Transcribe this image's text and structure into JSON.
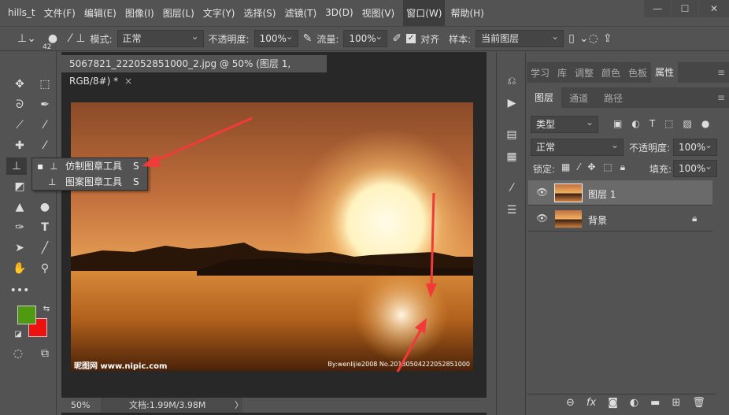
{
  "app": {
    "title": "hills_t"
  },
  "menu": [
    "文件(F)",
    "编辑(E)",
    "图像(I)",
    "图层(L)",
    "文字(Y)",
    "选择(S)",
    "滤镜(T)",
    "3D(D)",
    "视图(V)",
    "窗口(W)",
    "帮助(H)"
  ],
  "window_controls": {
    "minimize": "—",
    "maximize": "☐",
    "close": "✕"
  },
  "options": {
    "brush_size": "42",
    "mode_label": "模式:",
    "mode_value": "正常",
    "opacity_label": "不透明度:",
    "opacity_value": "100%",
    "flow_label": "流量:",
    "flow_value": "100%",
    "align_label": "对齐",
    "align_checked": true,
    "sample_label": "样本:",
    "sample_value": "当前图层"
  },
  "document": {
    "tab_title": "5067821_222052851000_2.jpg @ 50% (图层 1, RGB/8#) *",
    "close": "×",
    "watermark_left": "昵图网 www.nipic.com",
    "watermark_right": "By:wenlijie2008  No.20130504222052851000"
  },
  "status": {
    "zoom": "50%",
    "doc_size": "文档:1.99M/3.98M",
    "arrow": "〉"
  },
  "flyout": {
    "items": [
      {
        "label": "仿制图章工具",
        "shortcut": "S",
        "selected": true
      },
      {
        "label": "图案图章工具",
        "shortcut": "S",
        "selected": false
      }
    ]
  },
  "panels": {
    "top_tabs": [
      "学习",
      "库",
      "调整",
      "颜色",
      "色板",
      "属性"
    ],
    "active_top": "属性",
    "layer_tabs": [
      "图层",
      "通道",
      "路径"
    ],
    "filter_kind": "类型",
    "blend_mode": "正常",
    "opacity_label": "不透明度:",
    "opacity_value": "100%",
    "lock_label": "锁定:",
    "fill_label": "填充:",
    "fill_value": "100%",
    "layers": [
      {
        "name": "图层 1",
        "selected": true,
        "locked": false
      },
      {
        "name": "背景",
        "selected": false,
        "locked": true
      }
    ]
  },
  "colors": {
    "foreground": "#4f9a10",
    "background": "#ee1111",
    "accent_arrow": "#f23a3a"
  }
}
